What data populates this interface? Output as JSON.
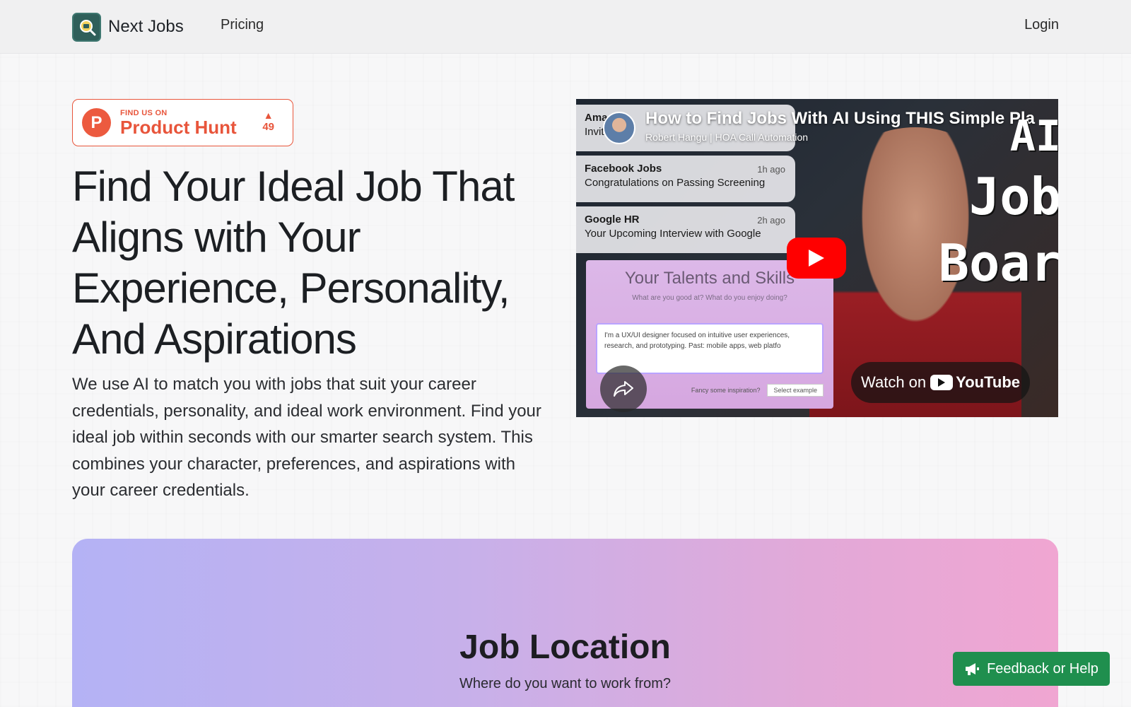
{
  "header": {
    "brand_name": "Next Jobs",
    "nav_pricing": "Pricing",
    "nav_login": "Login"
  },
  "product_hunt": {
    "small_text": "FIND US ON",
    "big_text": "Product Hunt",
    "votes": "49",
    "color": "#e8553b"
  },
  "hero": {
    "title": "Find Your Ideal Job That Aligns with Your Experience, Personality, And Aspirations",
    "description": "We use AI to match you with jobs that suit your career credentials, personality, and ideal work environment. Find your ideal job within seconds with our smarter search system. This combines your character, preferences, and aspirations with your career credentials."
  },
  "video": {
    "title": "How to Find Jobs With AI Using THIS Simple Pla",
    "channel": "Robert Hangu | HOA Call Automation",
    "notifications": [
      {
        "title": "Ama",
        "time": "",
        "body": "Invit"
      },
      {
        "title": "Facebook Jobs",
        "time": "1h ago",
        "body": "Congratulations on Passing Screening"
      },
      {
        "title": "Google HR",
        "time": "2h ago",
        "body": "Your Upcoming Interview with Google"
      }
    ],
    "talents_title": "Your Talents and Skills",
    "talents_sub": "What are you good at? What do you enjoy doing?",
    "talents_input": "I'm a UX/UI designer focused on intuitive user experiences, research, and prototyping. Past: mobile apps, web platfo",
    "talents_inspiration": "Fancy some inspiration?",
    "talents_select": "Select example",
    "big_words": [
      "AI",
      "Job",
      "Boar"
    ],
    "watch_on": "Watch on",
    "youtube": "YouTube",
    "play_color": "#ff0000"
  },
  "location": {
    "title": "Job Location",
    "subtitle": "Where do you want to work from?"
  },
  "feedback": {
    "label": "Feedback or Help",
    "color": "#1f8f4e"
  },
  "icons": {
    "brand": "briefcase-search-icon",
    "play": "play-icon",
    "share": "share-arrow-icon",
    "feedback": "megaphone-icon",
    "upvote": "triangle-up-icon"
  }
}
